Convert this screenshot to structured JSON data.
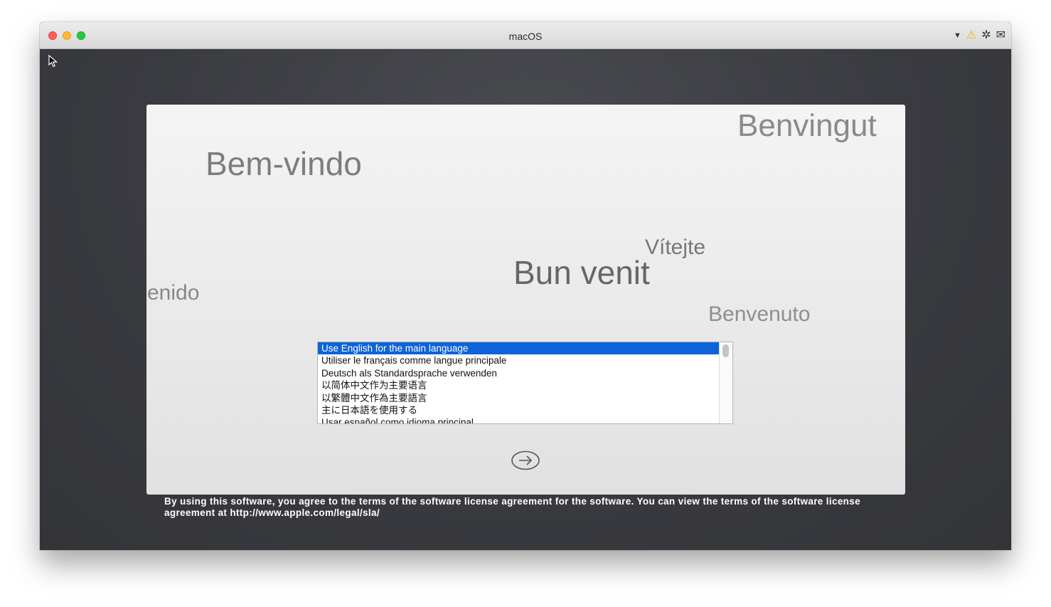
{
  "window": {
    "title": "macOS",
    "toolbar_icons": [
      "dropdown-triangle-icon",
      "warning-icon",
      "gear-icon",
      "envelope-icon"
    ]
  },
  "greetings": {
    "portuguese": "Bem-vindo",
    "catalan": "Benvingut",
    "czech": "Vítejte",
    "romanian": "Bun venit",
    "spanish_partial": "enido",
    "italian": "Benvenuto"
  },
  "language_list": {
    "selected_index": 0,
    "items": [
      "Use English for the main language",
      "Utiliser le français comme langue principale",
      "Deutsch als Standardsprache verwenden",
      "以简体中文作为主要语言",
      "以繁體中文作為主要語言",
      "主に日本語を使用する",
      "Usar español como idioma principal"
    ]
  },
  "license_text": "By using this software, you agree to the terms of the software license agreement for the software. You can view the terms of the software license agreement at http://www.apple.com/legal/sla/",
  "colors": {
    "selection": "#0e63d8",
    "background": "#3a3b40",
    "panel": "#eeeeee"
  }
}
